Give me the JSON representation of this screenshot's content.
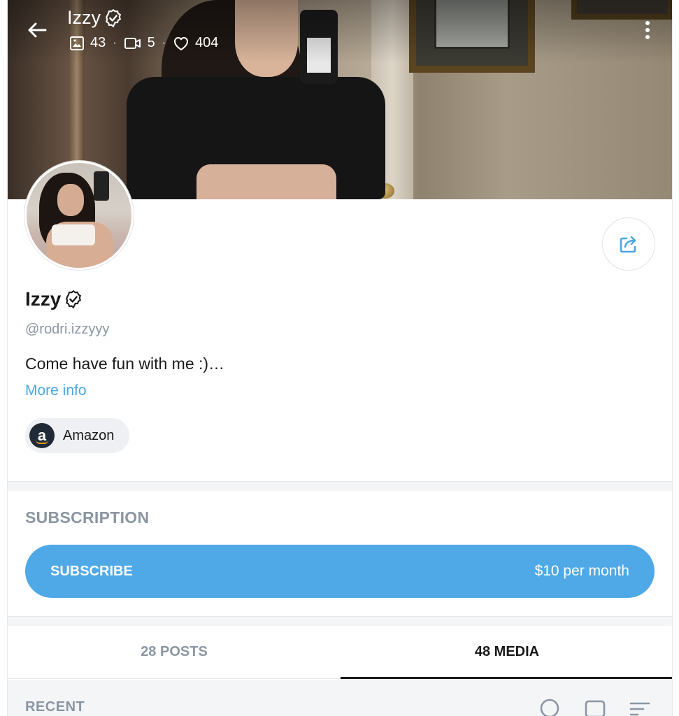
{
  "header": {
    "name": "Izzy",
    "stats": {
      "photos": "43",
      "videos": "5",
      "likes": "404"
    },
    "icons": [
      "back-arrow-icon",
      "verified-badge-icon",
      "image-icon",
      "video-icon",
      "heart-icon",
      "more-vert-icon"
    ]
  },
  "profile": {
    "name": "Izzy",
    "handle": "@rodri.izzyyy",
    "bio": "Come have fun with me :)…",
    "more_info": "More info",
    "link_label": "Amazon",
    "link_logo_letter": "a"
  },
  "subscription": {
    "title": "SUBSCRIPTION",
    "button_label": "SUBSCRIBE",
    "price": "$10 per month"
  },
  "tabs": [
    {
      "label": "28 POSTS",
      "active": false
    },
    {
      "label": "48 MEDIA",
      "active": true
    }
  ],
  "feed": {
    "section_label": "RECENT"
  },
  "colors": {
    "accent": "#4fa9e6",
    "link": "#47a7e6",
    "muted": "#8a96a3",
    "text": "#1a1a1a"
  }
}
